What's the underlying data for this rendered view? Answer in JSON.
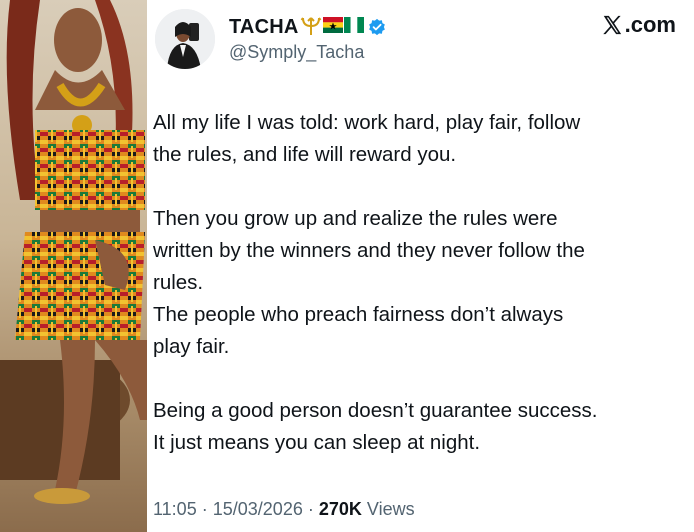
{
  "author": {
    "display_name": "TACHA",
    "name_emojis": [
      "trident-emoji",
      "ghana-flag-emoji",
      "nigeria-flag-emoji"
    ],
    "handle": "@Symply_Tacha",
    "verified": true
  },
  "brand": {
    "label": ".com",
    "icon": "x-logo-icon"
  },
  "tweet": {
    "lines": [
      "All my life I was told: work hard, play fair, follow",
      "the rules,  and life will reward you.",
      "",
      "Then you grow up and realize the rules were",
      "written by the winners and they never follow the",
      "rules.",
      "The people who preach fairness don’t always",
      "play fair.",
      "",
      "Being a good person doesn’t guarantee success.",
      "It just means you can sleep at night."
    ]
  },
  "meta": {
    "time": "11:05",
    "date": "15/03/2026",
    "separator": "·",
    "views_count": "270K",
    "views_label": "Views"
  },
  "colors": {
    "text_primary": "#0f1419",
    "text_secondary": "#536471",
    "verified_blue": "#1d9bf0",
    "trident_gold": "#d4a017"
  }
}
